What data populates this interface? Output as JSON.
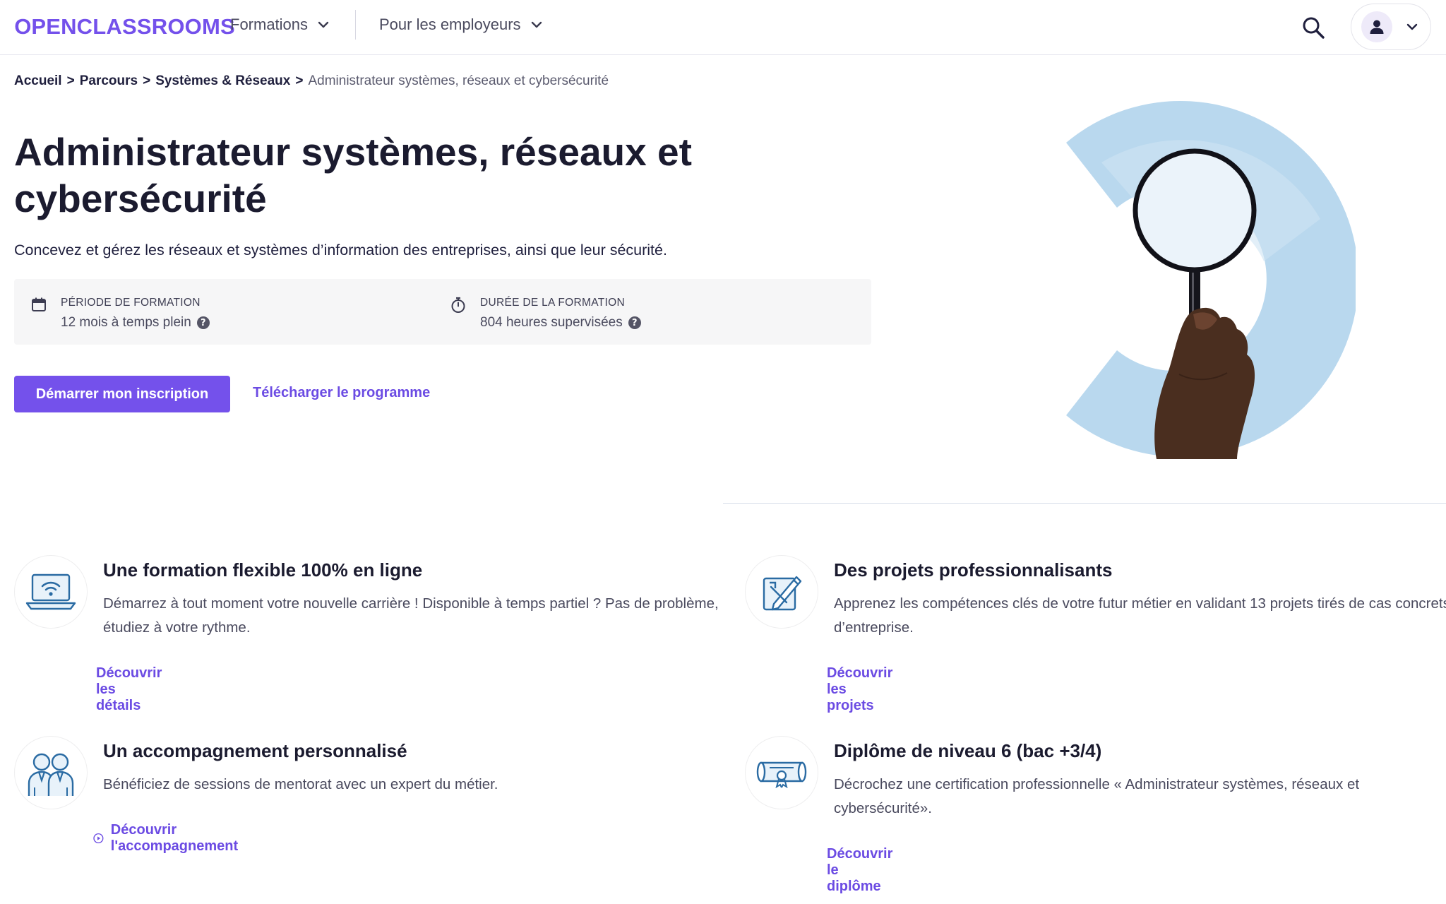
{
  "header": {
    "logo_mirrored_letter": "O",
    "logo_rest": "PENCLASSROOMS",
    "nav": [
      {
        "label": "Formations"
      },
      {
        "label": "Pour les employeurs"
      }
    ],
    "icons": {
      "search": "search-icon",
      "account": "user-icon",
      "dropdown": "chevron-down-icon"
    }
  },
  "breadcrumb": {
    "items": [
      {
        "label": "Accueil"
      },
      {
        "label": "Parcours"
      },
      {
        "label": "Systèmes & Réseaux"
      }
    ],
    "separator": ">",
    "current": "Administrateur systèmes, réseaux et cybersécurité"
  },
  "hero": {
    "title": "Administrateur systèmes, réseaux et cybersécurité",
    "subtitle": "Concevez et gérez les réseaux et systèmes d’information des entreprises, ainsi que leur sécurité.",
    "info": [
      {
        "icon": "calendar-icon",
        "label": "PÉRIODE DE FORMATION",
        "value": "12 mois à temps plein"
      },
      {
        "icon": "stopwatch-icon",
        "label": "DURÉE DE LA FORMATION",
        "value": "804 heures supervisées"
      }
    ],
    "help_glyph": "?",
    "cta_primary": "Démarrer mon inscription",
    "cta_secondary": "Télécharger le programme"
  },
  "features": [
    {
      "icon": "laptop-wifi-icon",
      "title": "Une formation flexible 100% en ligne",
      "desc": "Démarrez à tout moment votre nouvelle carrière ! Disponible à temps partiel ? Pas de problème, étudiez à votre rythme.",
      "link": "Découvrir les détails"
    },
    {
      "icon": "project-pencil-icon",
      "title": "Des projets professionnalisants",
      "desc": "Apprenez les compétences clés de votre futur métier en validant 13 projets tirés de cas concrets d’entreprise.",
      "link": "Découvrir les projets"
    },
    {
      "icon": "mentors-icon",
      "title": "Un accompagnement personnalisé",
      "desc": "Bénéficiez de sessions de mentorat avec un expert du métier.",
      "link": "Découvrir l'accompagnement"
    },
    {
      "icon": "diploma-icon",
      "title": "Diplôme de niveau 6 (bac +3/4)",
      "desc": "Décrochez une certification professionnelle « Administrateur systèmes, réseaux et cybersécurité».",
      "link": "Découvrir le diplôme"
    }
  ],
  "colors": {
    "brand": "#7451eb",
    "link": "#6b4be3",
    "heading": "#1b1b2f",
    "text": "#4a4a5e",
    "info_bg": "#f6f6f7",
    "illustration_light": "#b9d8ee",
    "icon_blue": "#2a6ba3"
  }
}
